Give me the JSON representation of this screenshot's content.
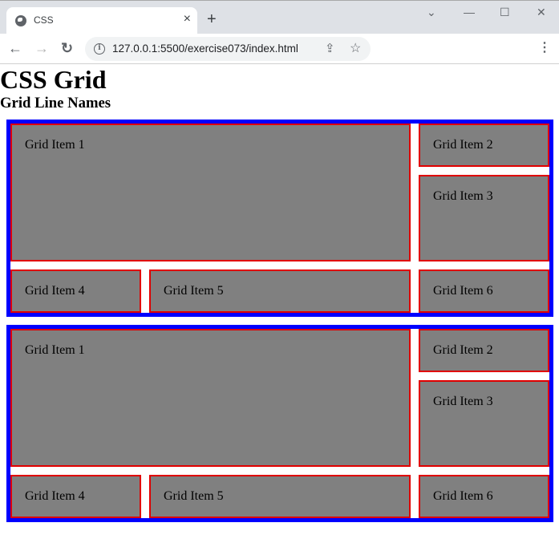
{
  "browser": {
    "tab_title": "CSS",
    "tab_close": "×",
    "new_tab": "+",
    "url": "127.0.0.1:5500/exercise073/index.html",
    "icons": {
      "favicon": "globe-icon",
      "back": "←",
      "forward": "→",
      "reload": "↻",
      "info": "i",
      "share": "⇪",
      "star": "☆",
      "menu": "⋮",
      "tab_search": "⌄",
      "minimize": "—",
      "maximize": "☐",
      "close": "✕"
    }
  },
  "page": {
    "title": "CSS Grid",
    "subtitle": "Grid Line Names",
    "colors": {
      "container_border": "#0000ff",
      "item_border": "#e00000",
      "item_background": "#808080"
    },
    "grids": [
      {
        "items": [
          "Grid Item 1",
          "Grid Item 2",
          "Grid Item 3",
          "Grid Item 4",
          "Grid Item 5",
          "Grid Item 6"
        ]
      },
      {
        "items": [
          "Grid Item 1",
          "Grid Item 2",
          "Grid Item 3",
          "Grid Item 4",
          "Grid Item 5",
          "Grid Item 6"
        ]
      }
    ]
  }
}
